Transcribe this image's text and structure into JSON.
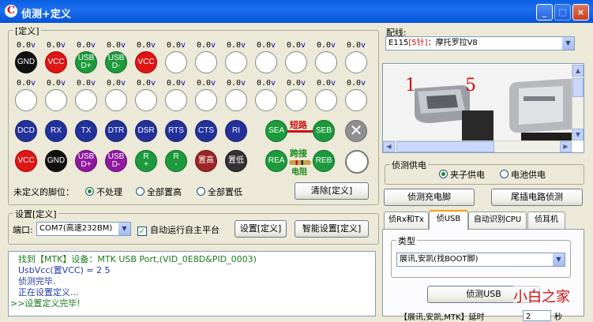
{
  "window": {
    "title": "侦测+定义",
    "min_label": "_",
    "max_label": "□",
    "close_label": "×"
  },
  "define_group": {
    "title": "[定义]",
    "row1": [
      {
        "volt": "0.0",
        "unit": "v",
        "label": "GND",
        "color": "black"
      },
      {
        "volt": "0.0",
        "unit": "v",
        "label": "VCC",
        "color": "red"
      },
      {
        "volt": "0.0",
        "unit": "v",
        "label": "USB D+",
        "color": "green"
      },
      {
        "volt": "0.0",
        "unit": "v",
        "label": "USB D-",
        "color": "green"
      },
      {
        "volt": "0.0",
        "unit": "v",
        "label": "VCC",
        "color": "red"
      },
      {
        "volt": "0.0",
        "unit": "v",
        "label": "",
        "color": "white"
      },
      {
        "volt": "0.0",
        "unit": "v",
        "label": "",
        "color": "white"
      },
      {
        "volt": "0.0",
        "unit": "v",
        "label": "",
        "color": "white"
      },
      {
        "volt": "0.0",
        "unit": "v",
        "label": "",
        "color": "white"
      },
      {
        "volt": "0.0",
        "unit": "v",
        "label": "",
        "color": "white"
      },
      {
        "volt": "0.0",
        "unit": "v",
        "label": "",
        "color": "white"
      },
      {
        "volt": "0.0",
        "unit": "v",
        "label": "",
        "color": "white"
      }
    ],
    "row2": [
      {
        "volt": "0.0",
        "unit": "v"
      },
      {
        "volt": "0.0",
        "unit": "v"
      },
      {
        "volt": "0.0",
        "unit": "v"
      },
      {
        "volt": "0.0",
        "unit": "v"
      },
      {
        "volt": "0.0",
        "unit": "v"
      },
      {
        "volt": "0.0",
        "unit": "v"
      },
      {
        "volt": "0.0",
        "unit": "v"
      },
      {
        "volt": "0.0",
        "unit": "v"
      },
      {
        "volt": "0.0",
        "unit": "v"
      },
      {
        "volt": "0.0",
        "unit": "v"
      },
      {
        "volt": "0.0",
        "unit": "v"
      },
      {
        "volt": "0.0",
        "unit": "v"
      }
    ],
    "signal_row": [
      "DCD",
      "RX",
      "TX",
      "DTR",
      "DSR",
      "RTS",
      "CTS",
      "RI"
    ],
    "power_row": [
      {
        "label": "VCC",
        "color": "red"
      },
      {
        "label": "GND",
        "color": "black"
      },
      {
        "label": "USB D+",
        "color": "purple"
      },
      {
        "label": "USB D-",
        "color": "purple"
      },
      {
        "label": "R +",
        "color": "green"
      },
      {
        "label": "R -",
        "color": "green"
      },
      {
        "label": "置高",
        "color": "brown"
      },
      {
        "label": "置低",
        "color": "dark"
      }
    ],
    "sea": "SEA",
    "seb": "SEB",
    "rea": "REA",
    "reb": "REB",
    "short_label": "短路",
    "jumper_label": "跨接",
    "resistor_label": "电阻",
    "clear_icon": "x-icon",
    "undefined_pins_label": "未定义的脚位：",
    "radio_options": [
      {
        "label": "不处理",
        "checked": true
      },
      {
        "label": "全部置高",
        "checked": false
      },
      {
        "label": "全部置低",
        "checked": false
      }
    ],
    "clear_button": "清除[定义]"
  },
  "settings_group": {
    "title": "设置[定义]",
    "port_label": "端口:",
    "port_value": "COM7(高速232BM)",
    "auto_run_label": "自动运行自主平台",
    "auto_run_checked": true,
    "set_button": "设置[定义]",
    "smart_button": "智能设置[定义]"
  },
  "log": [
    {
      "text": "找到【MTK】设备：MTK USB Port,(VID_0E8D&PID_0003)",
      "color": "#1a7a1a"
    },
    {
      "text": "UsbVcc(置VCC) = 2 5",
      "color": "#1f3aa8"
    },
    {
      "text": "侦测完毕.",
      "color": "#1f3aa8"
    },
    {
      "text": "正在设置定义...",
      "color": "#1f3aa8"
    },
    {
      "text": ">>设置定义完毕!",
      "color": "#1a7a1a"
    }
  ],
  "right": {
    "wiring_label": "配线:",
    "wiring_value_prefix": "E115",
    "wiring_value_pins": "[5针]",
    "wiring_value_name": "：摩托罗拉V8",
    "photo_label_1": "1",
    "photo_label_5": "5",
    "power_group_title": "侦测供电",
    "power_options": [
      {
        "label": "夹子供电",
        "checked": true
      },
      {
        "label": "电池供电",
        "checked": false
      }
    ],
    "detect_charge_button": "侦测充电脚",
    "tail_circuit_button": "尾插电路侦测",
    "tabs": [
      {
        "label": "侦Rx和Tx",
        "active": false
      },
      {
        "label": "侦USB",
        "active": true
      },
      {
        "label": "自动识别CPU",
        "active": false
      },
      {
        "label": "侦耳机",
        "active": false
      }
    ],
    "type_group_title": "类型",
    "type_value": "展讯,安凯(找BOOT脚)",
    "detect_usb_button": "侦测USB",
    "bottom_partial": "【展讯,安凯,MTK】延时",
    "delay_value": "2",
    "seconds_label": "秒",
    "watermark": "小白之家"
  }
}
